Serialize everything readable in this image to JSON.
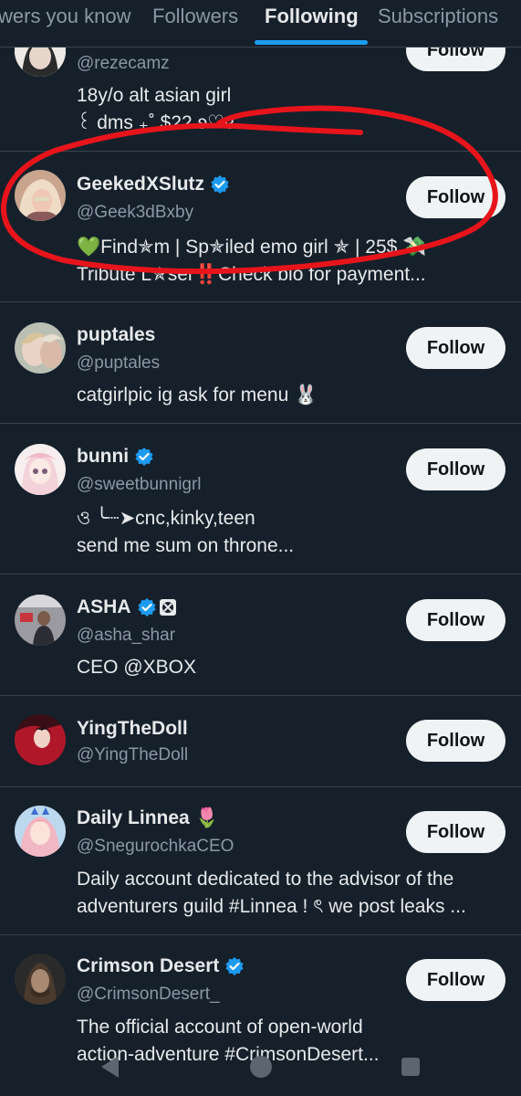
{
  "tabs": [
    {
      "label": "wers you know"
    },
    {
      "label": "Followers"
    },
    {
      "label": "Following"
    },
    {
      "label": "Subscriptions"
    }
  ],
  "accent_color": "#1d9bf0",
  "annotation_color": "#e8141b",
  "follow_label": "Follow",
  "accounts": [
    {
      "name": "",
      "handle": "@rezecamz",
      "bio": "18y/o alt asian girl\n꒰ dms ₊˚ $22 ʚ♡ɞ ..."
    },
    {
      "name": "GeekedXSlutz",
      "handle": "@Geek3dBxby",
      "bio": "💚Find✯m | Sp✯iled emo girl ✯ | 25$ 💸\nTribute L✯ser‼️Check bio for payment..."
    },
    {
      "name": "puptales",
      "handle": "@puptales",
      "bio": "catgirlpic ig ask for menu 🐰"
    },
    {
      "name": "bunni",
      "handle": "@sweetbunnigrl",
      "bio": "ও ╰┈➤cnc,kinky,teen\nsend me sum on throne..."
    },
    {
      "name": "ASHA",
      "handle": "@asha_shar",
      "bio": "CEO @XBOX"
    },
    {
      "name": "YingTheDoll",
      "handle": "@YingTheDoll",
      "bio": ""
    },
    {
      "name": "Daily Linnea 🌷",
      "handle": "@SnegurochkaCEO",
      "bio": "Daily account dedicated to the advisor of the\nadventurers guild #Linnea ! ৎ we post leaks ..."
    },
    {
      "name": "Crimson Desert",
      "handle": "@CrimsonDesert_",
      "bio": "The official account of open-world\naction-adventure #CrimsonDesert..."
    }
  ],
  "nav": {
    "back": "back-icon",
    "home": "home-icon",
    "recents": "recents-icon"
  }
}
